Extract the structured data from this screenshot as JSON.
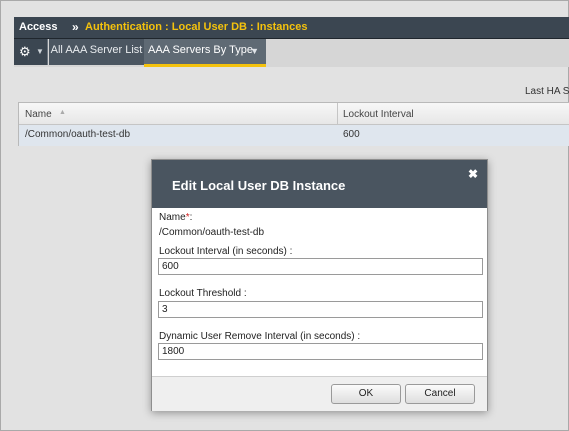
{
  "breadcrumb": {
    "root": "Access",
    "separator": "»",
    "path": "Authentication : Local User DB : Instances"
  },
  "tabs": {
    "settings_icon": "gear-icon",
    "list_tab": "All AAA Server List",
    "active_tab": "AAA Servers By Type"
  },
  "header_right": {
    "last_ha": "Last HA S"
  },
  "table": {
    "columns": [
      "Name",
      "Lockout Interval"
    ],
    "rows": [
      {
        "name": "/Common/oauth-test-db",
        "lockout_interval": "600"
      }
    ]
  },
  "dialog": {
    "title": "Edit Local User DB Instance",
    "close_icon": "close-icon",
    "name_label": "Name",
    "required_marker": "*",
    "name_suffix": ":",
    "name_value": "/Common/oauth-test-db",
    "lockout_interval_label": "Lockout Interval (in seconds) :",
    "lockout_interval_value": "600",
    "lockout_threshold_label": "Lockout Threshold :",
    "lockout_threshold_value": "3",
    "dynamic_remove_label": "Dynamic User Remove Interval (in seconds) :",
    "dynamic_remove_value": "1800",
    "ok_label": "OK",
    "cancel_label": "Cancel"
  },
  "colors": {
    "accent": "#f4c20d",
    "header_bg": "#3b4651",
    "dialog_header_bg": "#4a5560",
    "selected_row": "#dfe6ee",
    "required": "#d02020"
  }
}
